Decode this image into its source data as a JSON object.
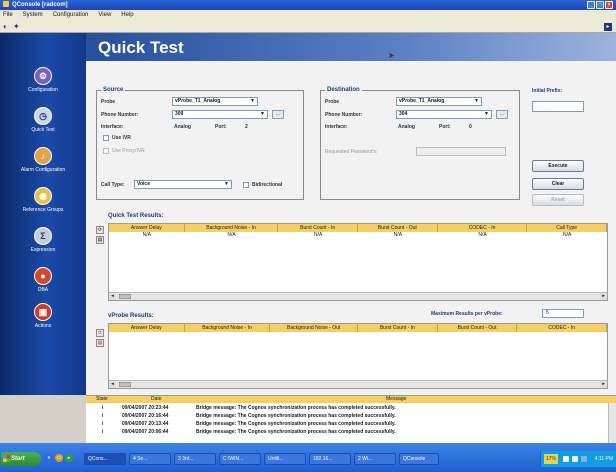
{
  "window": {
    "title": "QConsole [radcom]"
  },
  "menu": [
    "File",
    "System",
    "Configuration",
    "View",
    "Help"
  ],
  "nav": [
    {
      "label": "Configuration",
      "icon": "gear-icon",
      "glyph": "⚙",
      "color": "#7b5cc4"
    },
    {
      "label": "Quick Test",
      "icon": "stopwatch-icon",
      "glyph": "◷",
      "color": "#c9d6e8"
    },
    {
      "label": "Alarm Configuration",
      "icon": "bell-icon",
      "glyph": "♪",
      "color": "#e0a24a"
    },
    {
      "label": "Reference Groups",
      "icon": "group-icon",
      "glyph": "◉",
      "color": "#e3c14a"
    },
    {
      "label": "Expression",
      "icon": "expression-icon",
      "glyph": "Σ",
      "color": "#c8ccd6"
    },
    {
      "label": "DBA",
      "icon": "database-icon",
      "glyph": "●",
      "color": "#d2482e"
    },
    {
      "label": "Actions",
      "icon": "briefcase-icon",
      "glyph": "▣",
      "color": "#cc3b2a"
    }
  ],
  "page": {
    "title": "Quick Test"
  },
  "source": {
    "title": "Source",
    "probe_label": "Probe",
    "probe_value": "vProbe_T1_Analog",
    "phone_label": "Phone Number:",
    "phone_value": "309",
    "interface_label": "Interface:",
    "interface_value": "Analog",
    "port_label": "Port:",
    "port_value": "2",
    "use_ivr_label": "Use IVR",
    "use_proxy_label": "Use Proxy/IVR",
    "call_type_label": "Call Type:",
    "call_type_value": "Voice",
    "bidirectional_label": "Bidirectional"
  },
  "destination": {
    "title": "Destination",
    "probe_label": "Probe",
    "probe_value": "vProbe_T1_Analog",
    "phone_label": "Phone Number:",
    "phone_value": "304",
    "interface_label": "Interface:",
    "interface_value": "Analog",
    "port_label": "Port:",
    "port_value": "0",
    "password_label": "Requested Password's:"
  },
  "initial_prefix": {
    "label": "Initial Prefix:"
  },
  "buttons": {
    "execute": "Execute",
    "clear": "Clear",
    "reset": "Reset"
  },
  "quick_results": {
    "title": "Quick Test Results:",
    "columns": [
      "Answer Delay",
      "Background Noise - In",
      "Burst Count - In",
      "Burst Count - Out",
      "CODEC - In",
      "Call Type"
    ],
    "row": [
      "N/A",
      "N/A",
      "N/A",
      "N/A",
      "N/A",
      "N/A"
    ]
  },
  "vprobe_results": {
    "title": "vProbe Results:",
    "max_label": "Maximum Results per vProbe:",
    "max_value": "5",
    "columns": [
      "Answer Delay",
      "Background Noise - In",
      "Background Noise - Out",
      "Burst Count - In",
      "Burst Count - Out",
      "CODEC - In"
    ]
  },
  "log": {
    "columns": [
      "State",
      "Date",
      "Message"
    ],
    "rows": [
      {
        "state": "i",
        "date": "09/04/2007 20:23:44",
        "message": "Bridge message: The Cognos synchronization process has completed successfully."
      },
      {
        "state": "i",
        "date": "09/04/2007 20:16:44",
        "message": "Bridge message: The Cognos synchronization process has completed successfully."
      },
      {
        "state": "i",
        "date": "09/04/2007 20:13:44",
        "message": "Bridge message: The Cognos synchronization process has completed successfully."
      },
      {
        "state": "i",
        "date": "09/04/2007 20:06:44",
        "message": "Bridge message: The Cognos synchronization process has completed successfully."
      }
    ]
  },
  "taskbar": {
    "start": "Start",
    "tasks": [
      "QCons...",
      "4 Se...",
      "3 3rd...",
      "C:\\WIN...",
      "Untitl...",
      "192.16...",
      "2 Wi...",
      "QConsole"
    ],
    "tray_percent": "17%",
    "clock": "4:11 PM"
  }
}
